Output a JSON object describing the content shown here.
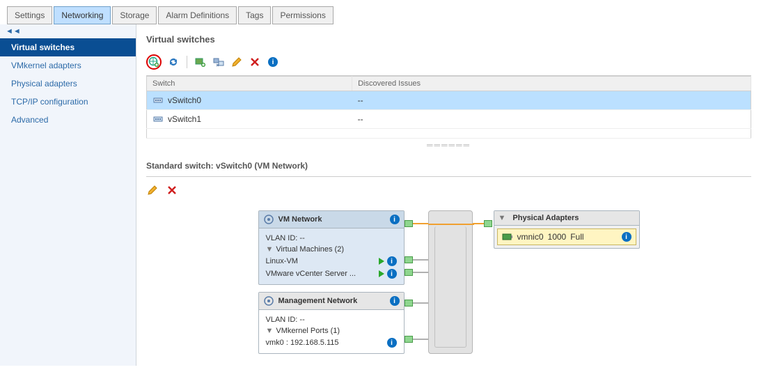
{
  "tabs": [
    "Settings",
    "Networking",
    "Storage",
    "Alarm Definitions",
    "Tags",
    "Permissions"
  ],
  "activeTab": "Networking",
  "sidebar": {
    "items": [
      "Virtual switches",
      "VMkernel adapters",
      "Physical adapters",
      "TCP/IP configuration",
      "Advanced"
    ],
    "active": "Virtual switches"
  },
  "section": {
    "title": "Virtual switches"
  },
  "table": {
    "cols": [
      "Switch",
      "Discovered Issues"
    ],
    "rows": [
      {
        "name": "vSwitch0",
        "issues": "--",
        "selected": true
      },
      {
        "name": "vSwitch1",
        "issues": "--",
        "selected": false
      }
    ]
  },
  "detail": {
    "header": "Standard switch: vSwitch0 (VM Network)"
  },
  "diagram": {
    "vmnet": {
      "title": "VM Network",
      "vlan": "VLAN ID: --",
      "group": "Virtual Machines (2)",
      "vms": [
        "Linux-VM",
        "VMware vCenter Server ..."
      ]
    },
    "mgmt": {
      "title": "Management Network",
      "vlan": "VLAN ID: --",
      "group": "VMkernel Ports (1)",
      "port": "vmk0 : 192.168.5.115"
    },
    "phys": {
      "title": "Physical Adapters",
      "nic": {
        "name": "vmnic0",
        "speed": "1000",
        "duplex": "Full"
      }
    }
  }
}
